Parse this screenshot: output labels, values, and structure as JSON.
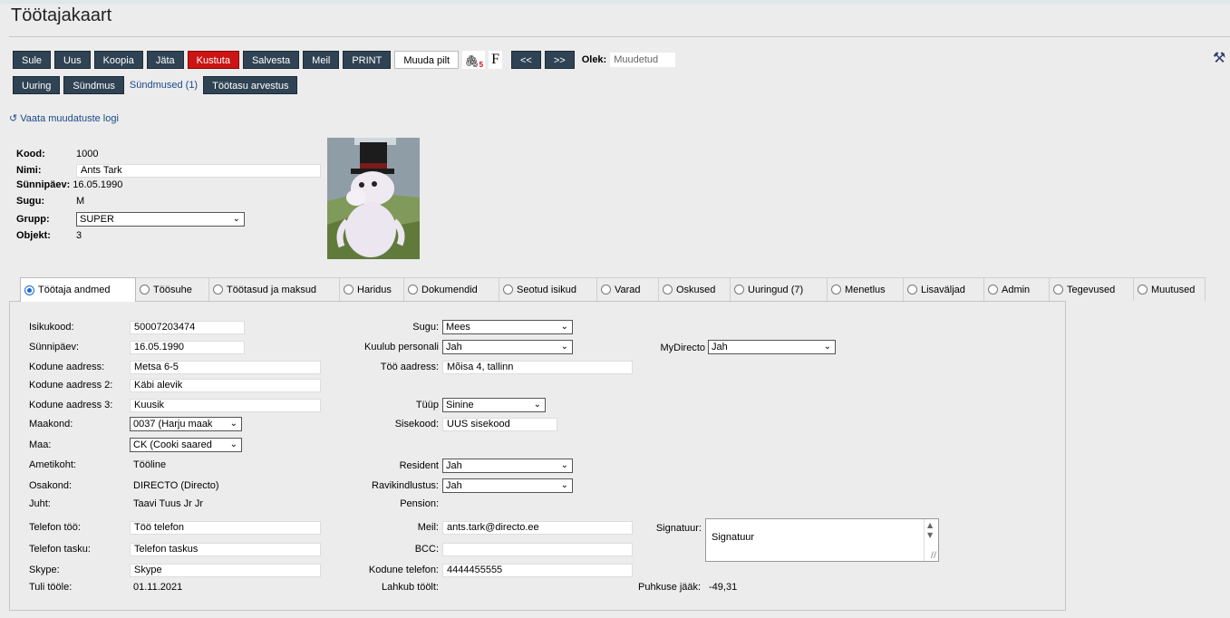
{
  "title": "Töötajakaart",
  "toolbar": {
    "row1": [
      "Sule",
      "Uus",
      "Koopia",
      "Jäta",
      "Kustuta",
      "Salvesta",
      "Meil",
      "PRINT"
    ],
    "muuda_pilt": "Muuda pilt",
    "attach_count": "5",
    "f_label": "F",
    "prev": "<<",
    "next": ">>",
    "olek_label": "Olek:",
    "olek_value": "Muudetud",
    "row2": [
      "Uuring",
      "Sündmus"
    ],
    "sundmused_link": "Sündmused (1)",
    "tootasu": "Töötasu arvestus"
  },
  "log_link": "Vaata muudatuste logi",
  "header": {
    "kood_label": "Kood:",
    "kood": "1000",
    "nimi_label": "Nimi:",
    "nimi": "Ants Tark",
    "sunnipaev_label": "Sünnipäev:",
    "sunnipaev": "16.05.1990",
    "sugu_label": "Sugu:",
    "sugu": "M",
    "grupp_label": "Grupp:",
    "grupp": "SUPER",
    "objekt_label": "Objekt:",
    "objekt": "3"
  },
  "tabs": [
    "Töötaja andmed",
    "Töösuhe",
    "Töötasud ja maksud",
    "Haridus",
    "Dokumendid",
    "Seotud isikud",
    "Varad",
    "Oskused",
    "Uuringud (7)",
    "Menetlus",
    "Lisaväljad",
    "Admin",
    "Tegevused",
    "Muutused"
  ],
  "form": {
    "isikukood_label": "Isikukood:",
    "isikukood": "50007203474",
    "sunnipaev_label": "Sünnipäev:",
    "sunnipaev": "16.05.1990",
    "kodune1_label": "Kodune aadress:",
    "kodune1": "Metsa 6-5",
    "kodune2_label": "Kodune aadress 2:",
    "kodune2": "Käbi alevik",
    "kodune3_label": "Kodune aadress 3:",
    "kodune3": "Kuusik",
    "maakond_label": "Maakond:",
    "maakond": "0037 (Harju maak",
    "maa_label": "Maa:",
    "maa": "CK (Cooki saared",
    "ametikoht_label": "Ametikoht:",
    "ametikoht": "Tööline",
    "osakond_label": "Osakond:",
    "osakond": "DIRECTO (Directo)",
    "juht_label": "Juht:",
    "juht": "Taavi Tuus Jr Jr",
    "tel_too_label": "Telefon töö:",
    "tel_too": "Töö telefon",
    "tel_tasku_label": "Telefon tasku:",
    "tel_tasku": "Telefon taskus",
    "skype_label": "Skype:",
    "skype": "Skype",
    "tuli_label": "Tuli tööle:",
    "tuli": "01.11.2021",
    "sugu_label": "Sugu:",
    "sugu": "Mees",
    "kuulub_label": "Kuulub personali",
    "kuulub": "Jah",
    "too_aadress_label": "Töö aadress:",
    "too_aadress": "Mõisa 4, tallinn",
    "tuup_label": "Tüüp",
    "tuup": "Sinine",
    "sisekood_label": "Sisekood:",
    "sisekood": "UUS sisekood",
    "resident_label": "Resident",
    "resident": "Jah",
    "ravi_label": "Ravikindlustus:",
    "ravi": "Jah",
    "pension_label": "Pension:",
    "meil_label": "Meil:",
    "meil": "ants.tark@directo.ee",
    "bcc_label": "BCC:",
    "kodune_tel_label": "Kodune telefon:",
    "kodune_tel": "4444455555",
    "lahkub_label": "Lahkub töölt:",
    "mydirecto_label": "MyDirecto",
    "mydirecto": "Jah",
    "signatuur_label": "Signatuur:",
    "signatuur": "Signatuur",
    "puhkus_label": "Puhkuse jääk:",
    "puhkus": "-49,31"
  }
}
